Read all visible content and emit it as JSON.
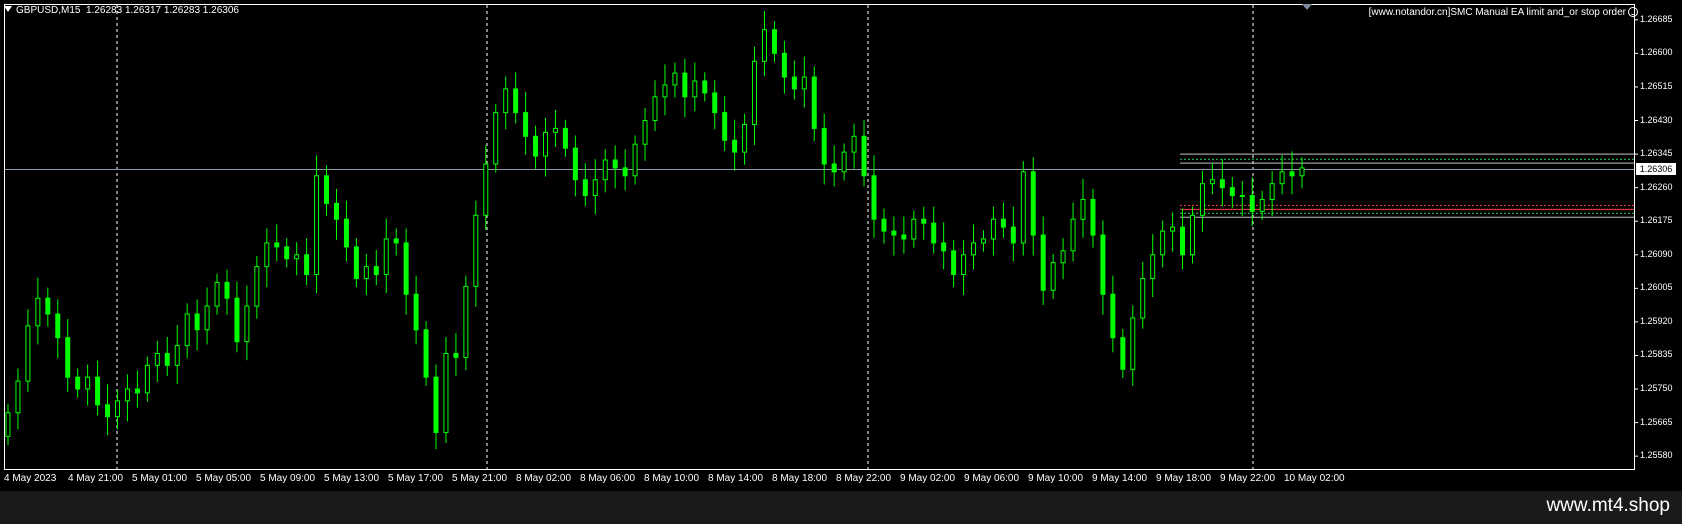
{
  "header": {
    "symbol": "GBPUSD,M15",
    "ohlc": "1.26283 1.26317 1.26283 1.26306"
  },
  "ea_label": "[www.notandor.cn]SMC Manual EA limit and_or stop order",
  "current_price": "1.26306",
  "price_axis": [
    "1.26685",
    "1.26600",
    "1.26515",
    "1.26430",
    "1.26345",
    "1.26260",
    "1.26175",
    "1.26090",
    "1.26005",
    "1.25920",
    "1.25835",
    "1.25750",
    "1.25665",
    "1.25580"
  ],
  "time_axis": [
    "4 May 2023",
    "4 May 21:00",
    "5 May 01:00",
    "5 May 05:00",
    "5 May 09:00",
    "5 May 13:00",
    "5 May 17:00",
    "5 May 21:00",
    "8 May 02:00",
    "8 May 06:00",
    "8 May 10:00",
    "8 May 14:00",
    "8 May 18:00",
    "8 May 22:00",
    "9 May 02:00",
    "9 May 06:00",
    "9 May 10:00",
    "9 May 14:00",
    "9 May 18:00",
    "9 May 22:00",
    "10 May 02:00"
  ],
  "watermark": "www.mt4.shop",
  "colors": {
    "background": "#000000",
    "candle": "#00ff00",
    "bid_line": "#8c9aa8",
    "zone_upper": "#c0c0c0",
    "zone_red": "#ff4040",
    "zone_green": "#33cc66"
  },
  "chart_data": {
    "type": "candlestick",
    "ylim": [
      1.2555,
      1.2672
    ],
    "bid": 1.26306,
    "zones": [
      1.26345,
      1.26332,
      1.26322,
      1.26215,
      1.26205,
      1.26195,
      1.26185
    ],
    "close": [
      1.2569,
      1.2577,
      1.2591,
      1.2598,
      1.2594,
      1.2588,
      1.2578,
      1.2575,
      1.2578,
      1.2571,
      1.2568,
      1.2572,
      1.2575,
      1.2574,
      1.2581,
      1.2584,
      1.2581,
      1.2586,
      1.2594,
      1.259,
      1.2596,
      1.2602,
      1.2598,
      1.2587,
      1.2596,
      1.2606,
      1.2612,
      1.2611,
      1.2608,
      1.2609,
      1.2604,
      1.2629,
      1.2622,
      1.2618,
      1.2611,
      1.2603,
      1.2606,
      1.2604,
      1.2613,
      1.2612,
      1.2599,
      1.259,
      1.2578,
      1.2564,
      1.2584,
      1.2583,
      1.2601,
      1.2619,
      1.2632,
      1.2645,
      1.2651,
      1.2645,
      1.2639,
      1.2634,
      1.264,
      1.2641,
      1.2636,
      1.2628,
      1.2624,
      1.2628,
      1.2633,
      1.2631,
      1.2629,
      1.2637,
      1.2643,
      1.2649,
      1.2652,
      1.2655,
      1.2649,
      1.2653,
      1.265,
      1.2645,
      1.2638,
      1.2635,
      1.2642,
      1.2658,
      1.2666,
      1.266,
      1.2654,
      1.2651,
      1.2654,
      1.2641,
      1.2632,
      1.263,
      1.2635,
      1.2639,
      1.2629,
      1.2618,
      1.2615,
      1.2614,
      1.2613,
      1.2618,
      1.2617,
      1.2612,
      1.261,
      1.2604,
      1.2609,
      1.2612,
      1.2613,
      1.2618,
      1.2616,
      1.2612,
      1.263,
      1.2614,
      1.26,
      1.2607,
      1.261,
      1.2618,
      1.2623,
      1.2614,
      1.2599,
      1.2588,
      1.258,
      1.2593,
      1.2603,
      1.2609,
      1.2615,
      1.2616,
      1.2609,
      1.2619,
      1.2627,
      1.2628,
      1.2626,
      1.2624,
      1.2624,
      1.262,
      1.2623,
      1.2627,
      1.263,
      1.2629,
      1.2631
    ]
  }
}
